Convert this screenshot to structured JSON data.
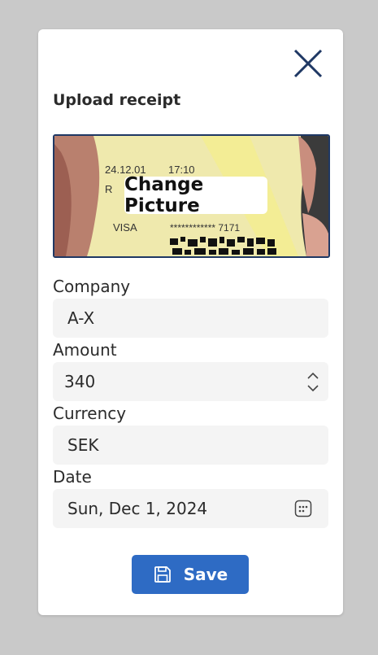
{
  "dialog": {
    "title": "Upload receipt",
    "change_picture_label": "Change Picture",
    "receipt_preview": {
      "date": "24.12.01",
      "time": "17:10",
      "card": "VISA",
      "card_number": "************ 7171",
      "partial_text": "R"
    }
  },
  "form": {
    "company_label": "Company",
    "company_value": "A-X",
    "amount_label": "Amount",
    "amount_value": "340",
    "currency_label": "Currency",
    "currency_value": "SEK",
    "date_label": "Date",
    "date_value": "Sun, Dec 1, 2024"
  },
  "actions": {
    "save_label": "Save"
  },
  "icons": {
    "close": "close-icon",
    "stepper_up": "chevron-up-icon",
    "stepper_down": "chevron-down-icon",
    "calendar": "calendar-icon",
    "save": "floppy-disk-icon"
  },
  "colors": {
    "accent": "#2e6bc4",
    "close_icon": "#1f3864",
    "field_bg": "#f4f4f4",
    "backdrop": "#c9c9c9"
  }
}
